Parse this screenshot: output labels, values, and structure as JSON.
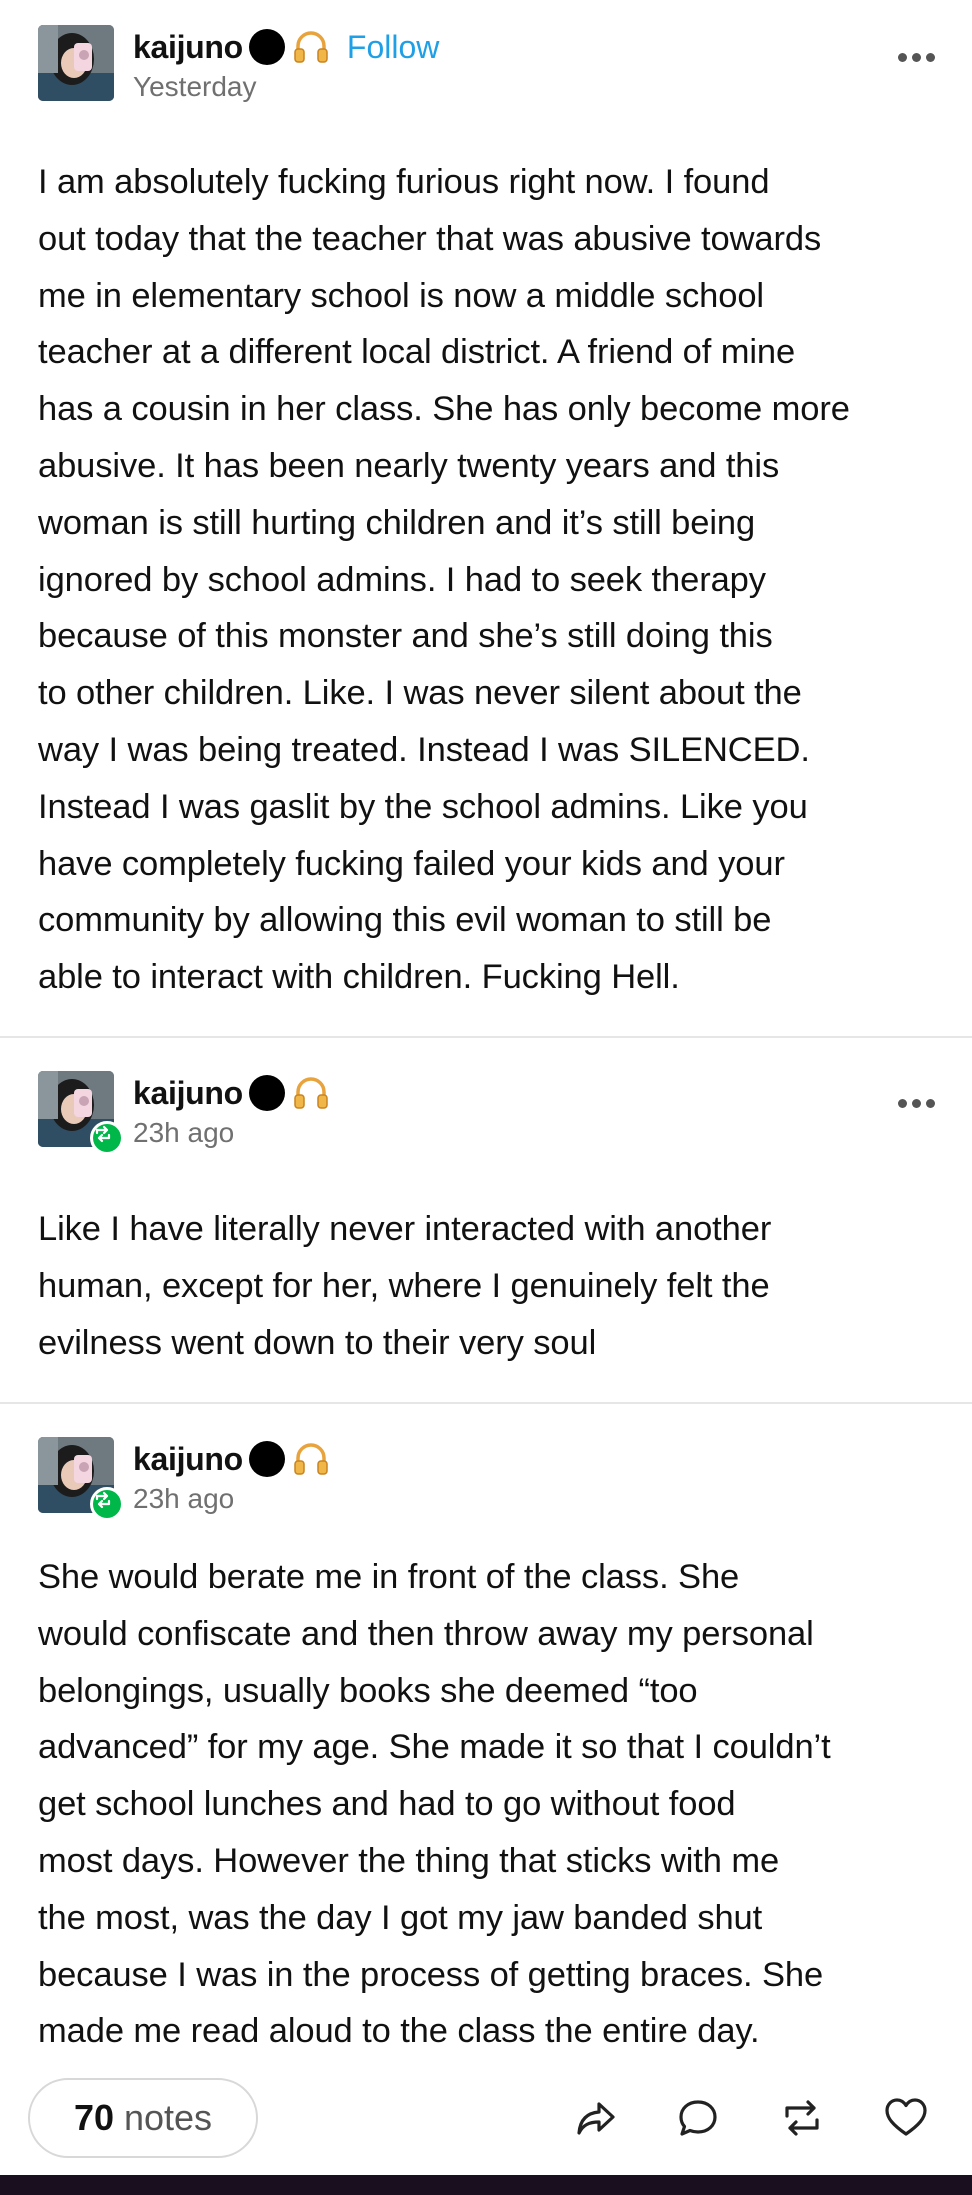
{
  "posts": [
    {
      "username": "kaijuno",
      "follow_label": "Follow",
      "timestamp": "Yesterday",
      "body": "I am absolutely fucking furious right now. I found\nout today that the teacher that was abusive towards\nme in elementary school is now a middle school\nteacher at a different local district. A friend of mine\nhas a cousin in her class. She has only become more\nabusive. It has been nearly twenty years and this\nwoman is still hurting children and it’s still being\nignored by school admins. I had to seek therapy\nbecause of this monster and she’s still doing this\nto other children. Like. I was never silent about the\nway I was being treated. Instead I was SILENCED.\nInstead I was gaslit by the school admins. Like you\nhave completely fucking failed your kids and your\ncommunity by allowing this evil woman to still be\nable to interact with children. Fucking Hell."
    },
    {
      "username": "kaijuno",
      "timestamp": "23h ago",
      "body": "Like I have literally never interacted with another\nhuman, except for her, where I genuinely felt the\nevilness went down to their very soul"
    },
    {
      "username": "kaijuno",
      "timestamp": "23h ago",
      "body": "She would berate me in front of the class. She\nwould confiscate and then throw away my personal\nbelongings, usually books she deemed “too\nadvanced” for my age. She made it so that I couldn’t\nget school lunches and had to go without food\nmost days. However the thing that sticks with me\nthe most, was the day I got my jaw banded shut\nbecause I was in the process of getting braces. She\nmade me read aloud to the class the entire day."
    }
  ],
  "footer": {
    "notes_count": "70",
    "notes_label": "notes"
  },
  "colors": {
    "follow": "#1fa0e6",
    "reblog_badge": "#00b84a",
    "text": "#111111",
    "muted": "#707070"
  },
  "icons": [
    "more-options-icon",
    "headphones-icon",
    "reblog-badge-icon",
    "share-icon",
    "reply-icon",
    "reblog-icon",
    "like-icon"
  ]
}
